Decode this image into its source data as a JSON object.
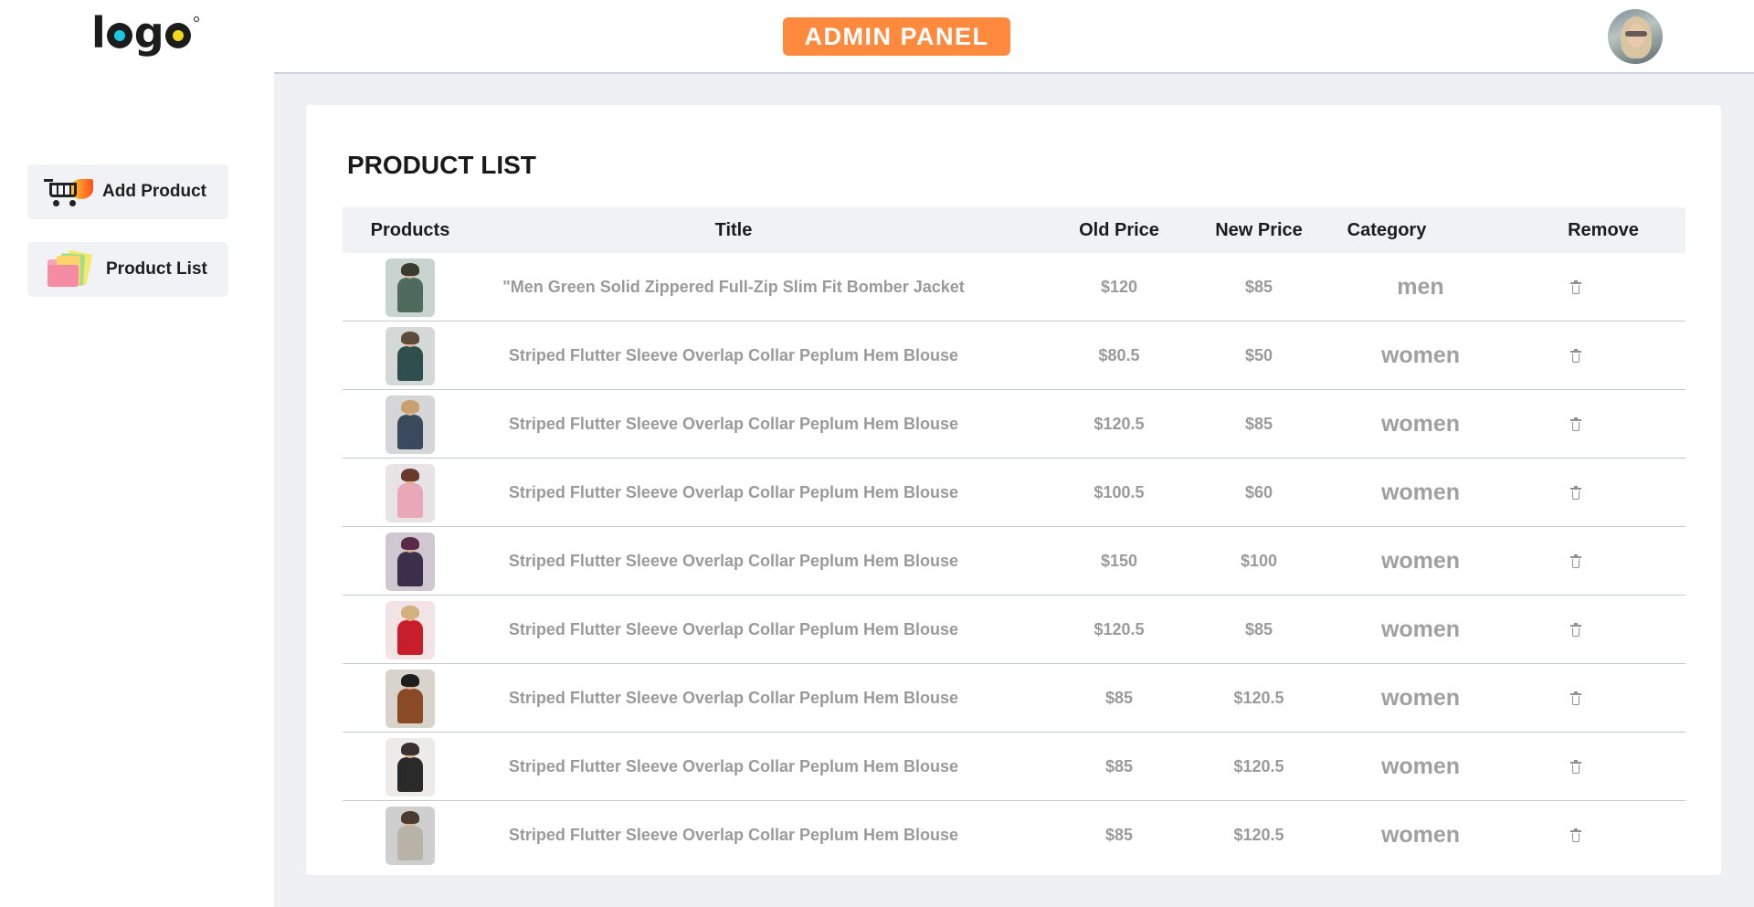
{
  "header": {
    "logo_text": "logo",
    "badge_label": "ADMIN PANEL",
    "badge_color": "#ff8a3d"
  },
  "sidebar": {
    "items": [
      {
        "label": "Add Product",
        "icon": "cart-flame-icon"
      },
      {
        "label": "Product List",
        "icon": "folder-files-icon"
      }
    ]
  },
  "main": {
    "title": "PRODUCT LIST",
    "columns": [
      "Products",
      "Title",
      "Old Price",
      "New Price",
      "Category",
      "Remove"
    ],
    "rows": [
      {
        "title": "\"Men Green Solid Zippered Full-Zip Slim Fit Bomber Jacket",
        "old_price": "$120",
        "new_price": "$85",
        "category": "men"
      },
      {
        "title": "Striped Flutter Sleeve Overlap Collar Peplum Hem Blouse",
        "old_price": "$80.5",
        "new_price": "$50",
        "category": "women"
      },
      {
        "title": "Striped Flutter Sleeve Overlap Collar Peplum Hem Blouse",
        "old_price": "$120.5",
        "new_price": "$85",
        "category": "women"
      },
      {
        "title": "Striped Flutter Sleeve Overlap Collar Peplum Hem Blouse",
        "old_price": "$100.5",
        "new_price": "$60",
        "category": "women"
      },
      {
        "title": "Striped Flutter Sleeve Overlap Collar Peplum Hem Blouse",
        "old_price": "$150",
        "new_price": "$100",
        "category": "women"
      },
      {
        "title": "Striped Flutter Sleeve Overlap Collar Peplum Hem Blouse",
        "old_price": "$120.5",
        "new_price": "$85",
        "category": "women"
      },
      {
        "title": "Striped Flutter Sleeve Overlap Collar Peplum Hem Blouse",
        "old_price": "$85",
        "new_price": "$120.5",
        "category": "women"
      },
      {
        "title": "Striped Flutter Sleeve Overlap Collar Peplum Hem Blouse",
        "old_price": "$85",
        "new_price": "$120.5",
        "category": "women"
      },
      {
        "title": "Striped Flutter Sleeve Overlap Collar Peplum Hem Blouse",
        "old_price": "$85",
        "new_price": "$120.5",
        "category": "women"
      }
    ]
  }
}
